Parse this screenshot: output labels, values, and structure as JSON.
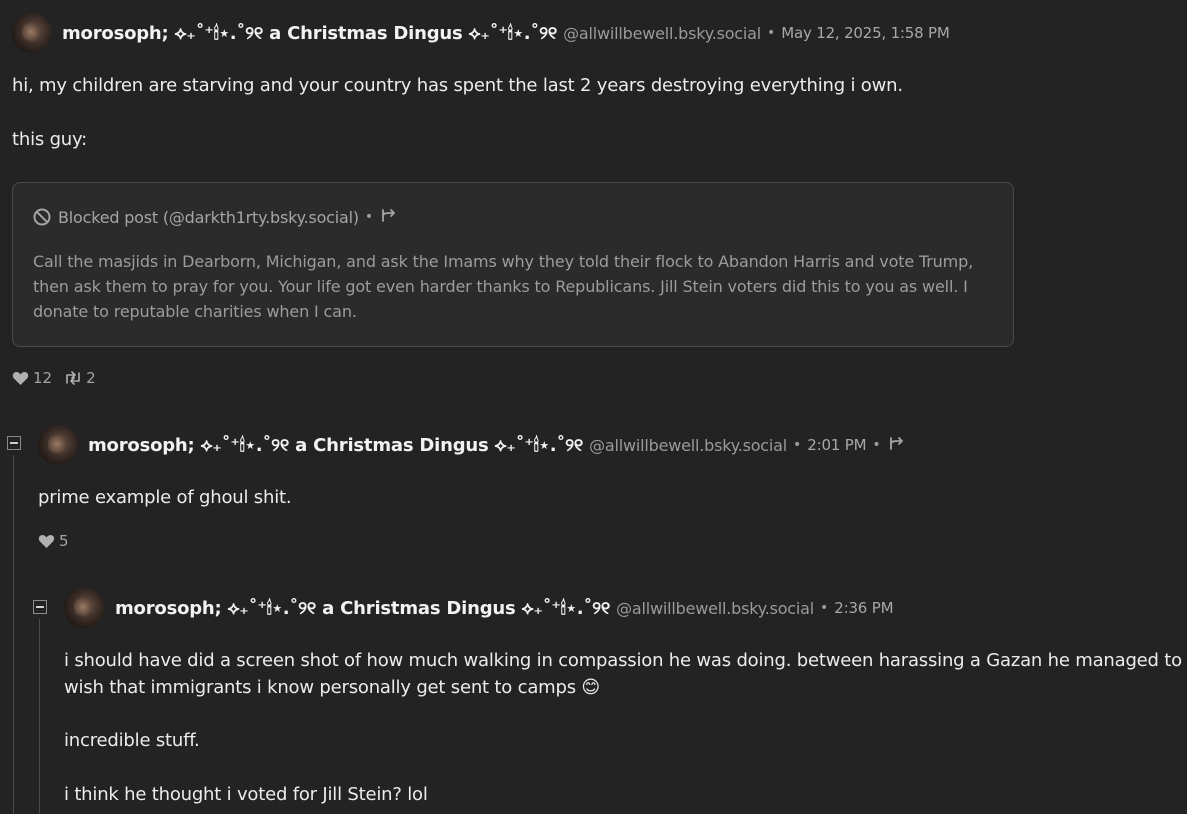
{
  "post": {
    "author_name": "morosoph; ⟡₊˚⁺🕯⋆.˚୨୧ a Christmas Dingus ⟡₊˚⁺🕯⋆.˚୨୧",
    "handle": "@allwillbewell.bsky.social",
    "timestamp": "May 12, 2025, 1:58 PM",
    "paragraphs": [
      "hi, my children are starving and your country has spent the last 2 years destroying everything i own.",
      "this guy:"
    ],
    "quote": {
      "label": "Blocked post (@darkth1rty.bsky.social)",
      "text": "Call the masjids in Dearborn, Michigan, and ask the Imams why they told their flock to Abandon Harris and vote Trump, then ask them to pray for you. Your life got even harder thanks to Republicans. Jill Stein voters did this to you as well. I donate to reputable charities when I can."
    },
    "likes": "12",
    "reposts": "2"
  },
  "reply1": {
    "author_name": "morosoph; ⟡₊˚⁺🕯⋆.˚୨୧ a Christmas Dingus ⟡₊˚⁺🕯⋆.˚୨୧",
    "handle": "@allwillbewell.bsky.social",
    "timestamp": "2:01 PM",
    "text": "prime example of ghoul shit.",
    "likes": "5"
  },
  "reply2": {
    "author_name": "morosoph; ⟡₊˚⁺🕯⋆.˚୨୧ a Christmas Dingus ⟡₊˚⁺🕯⋆.˚୨୧",
    "handle": "@allwillbewell.bsky.social",
    "timestamp": "2:36 PM",
    "paragraphs": [
      "i should have did a screen shot of how much walking in compassion he was doing. between harassing a Gazan he managed to wish that immigrants i know personally get sent to camps 😊",
      "incredible stuff.",
      "i think he thought i voted for Jill Stein? lol"
    ]
  },
  "separator": "•",
  "icons": {
    "avatar": "profile-photo",
    "blocked": "ban-icon",
    "open_thread": "branch-arrow-icon",
    "like": "heart-icon",
    "repost": "repost-icon",
    "collapse": "minus-box-icon"
  },
  "colors": {
    "background": "#232323",
    "text": "#ececec",
    "muted": "#9a9a9a",
    "quote_bg": "#2b2b2b",
    "border": "#4a4a4a"
  }
}
